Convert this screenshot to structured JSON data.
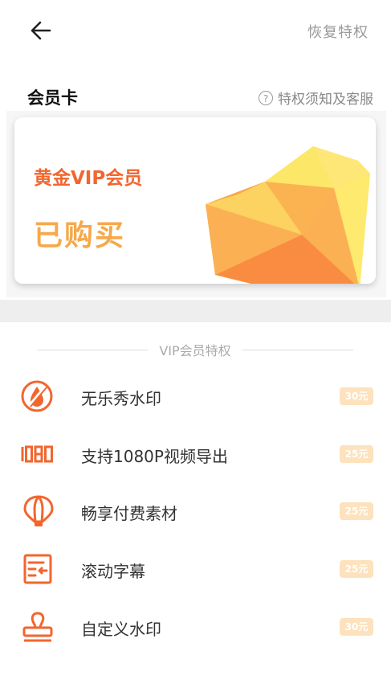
{
  "header": {
    "restore_label": "恢复特权"
  },
  "membership": {
    "section_title": "会员卡",
    "help_label": "特权须知及客服",
    "help_icon": "question-circle-icon",
    "level": "黄金VIP会员",
    "status": "已购买"
  },
  "privileges": {
    "title": "VIP会员特权",
    "items": [
      {
        "icon": "no-watermark-drop-icon",
        "label": "无乐秀水印",
        "price": "30元"
      },
      {
        "icon": "1080-text-icon",
        "label": "支持1080P视频导出",
        "price": "25元"
      },
      {
        "icon": "balloon-icon",
        "label": "畅享付费素材",
        "price": "25元"
      },
      {
        "icon": "scrolling-caption-icon",
        "label": "滚动字幕",
        "price": "25元"
      },
      {
        "icon": "stamp-icon",
        "label": "自定义水印",
        "price": "30元"
      }
    ]
  },
  "colors": {
    "accent": "#f2662e",
    "status_gold": "#f7a84a",
    "badge_bg": "#fde2bd"
  }
}
